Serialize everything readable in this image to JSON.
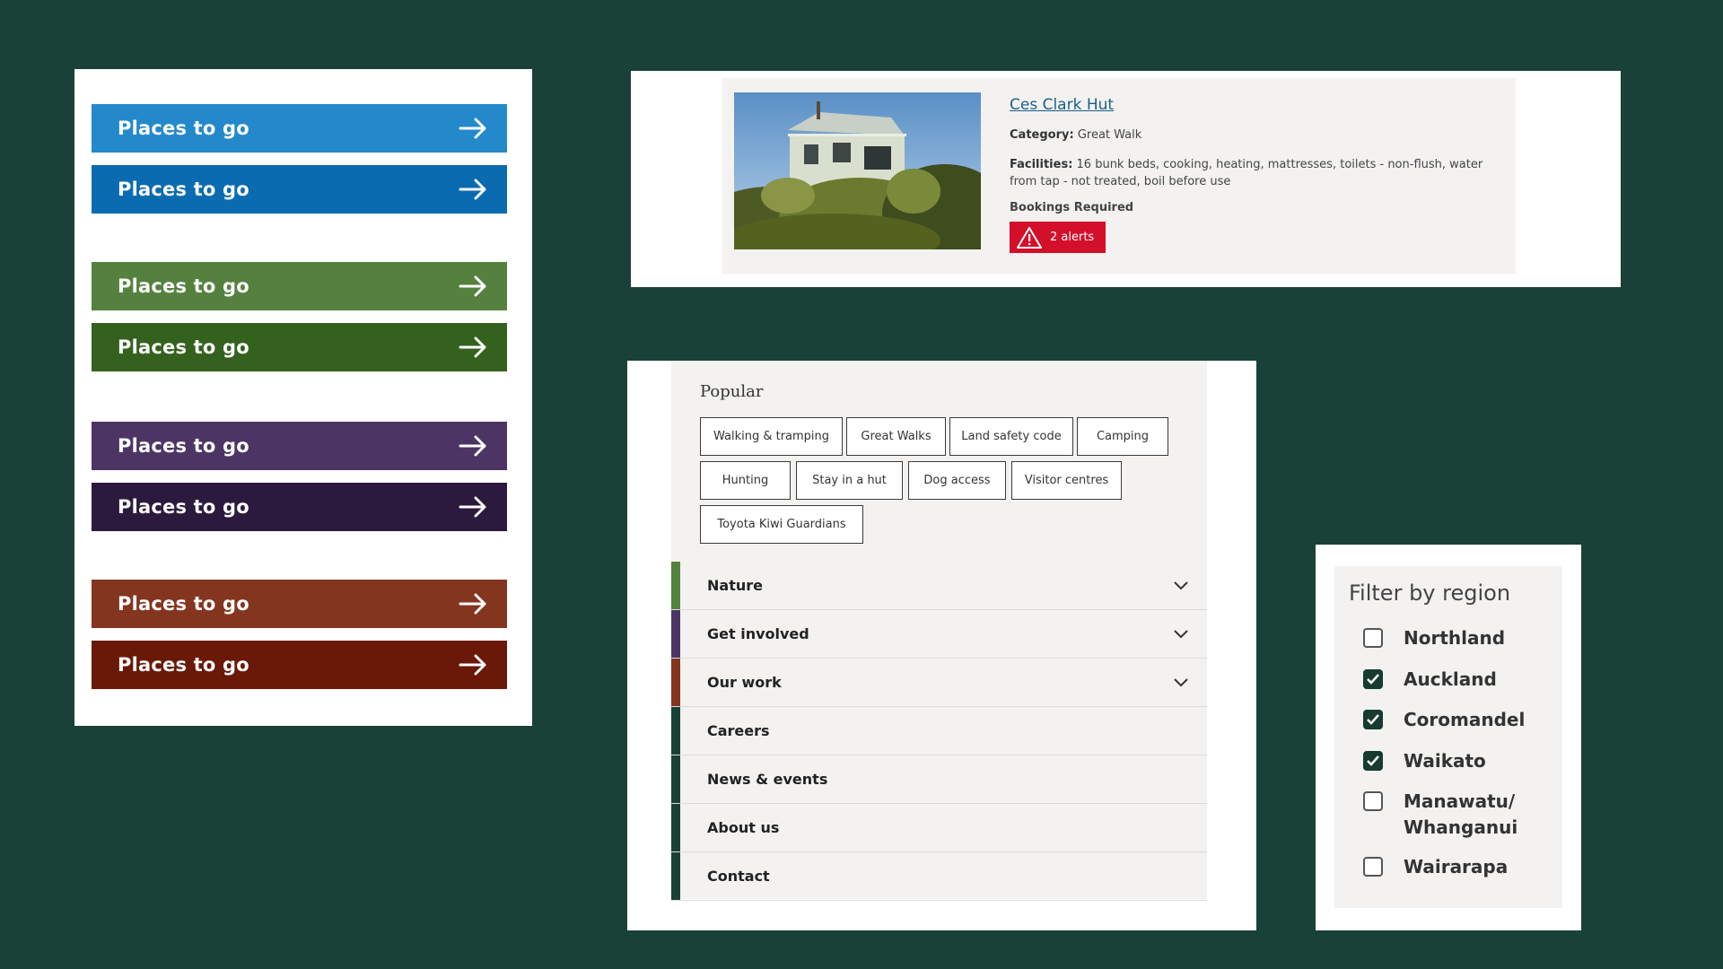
{
  "colors": {
    "background": "#1a4137",
    "blue": "#2389cb",
    "blue_dark": "#0a6bb0",
    "green": "#54823e",
    "green_dark": "#35611f",
    "purple": "#4c3565",
    "purple_dark": "#2b1a3d",
    "rust": "#84351f",
    "rust_dark": "#6a1908",
    "alert_red": "#d40f2a",
    "link_blue": "#1a5f8a"
  },
  "buttons": [
    {
      "label": "Places to go",
      "icon": "arrow-right-icon"
    },
    {
      "label": "Places to go",
      "icon": "arrow-right-icon"
    },
    {
      "label": "Places to go",
      "icon": "arrow-right-icon"
    },
    {
      "label": "Places to go",
      "icon": "arrow-right-icon"
    },
    {
      "label": "Places to go",
      "icon": "arrow-right-icon"
    },
    {
      "label": "Places to go",
      "icon": "arrow-right-icon"
    },
    {
      "label": "Places to go",
      "icon": "arrow-right-icon"
    },
    {
      "label": "Places to go",
      "icon": "arrow-right-icon"
    }
  ],
  "hut_card": {
    "title": "Ces Clark Hut",
    "category_label": "Category:",
    "category_value": "Great Walk",
    "facilities_label": "Facilities:",
    "facilities_value": "16 bunk beds, cooking, heating, mattresses, toilets - non-flush, water from tap - not treated, boil before use",
    "bookings": "Bookings Required",
    "alerts": "2 alerts",
    "alert_icon": "warning-triangle-icon"
  },
  "menu": {
    "popular_title": "Popular",
    "tags": [
      "Walking & tramping",
      "Great Walks",
      "Land safety code",
      "Camping",
      "Hunting",
      "Stay in a hut",
      "Dog access",
      "Visitor centres",
      "Toyota Kiwi Guardians"
    ],
    "items": [
      {
        "label": "Nature",
        "expandable": true
      },
      {
        "label": "Get involved",
        "expandable": true
      },
      {
        "label": "Our work",
        "expandable": true
      },
      {
        "label": "Careers",
        "expandable": false
      },
      {
        "label": "News & events",
        "expandable": false
      },
      {
        "label": "About us",
        "expandable": false
      },
      {
        "label": "Contact",
        "expandable": false
      }
    ]
  },
  "filter": {
    "title": "Filter by region",
    "regions": [
      {
        "label": "Northland",
        "checked": false
      },
      {
        "label": "Auckland",
        "checked": true
      },
      {
        "label": "Coromandel",
        "checked": true
      },
      {
        "label": "Waikato",
        "checked": true
      },
      {
        "label": "Manawatu/ Whanganui",
        "checked": false
      },
      {
        "label": "Wairarapa",
        "checked": false
      }
    ]
  }
}
